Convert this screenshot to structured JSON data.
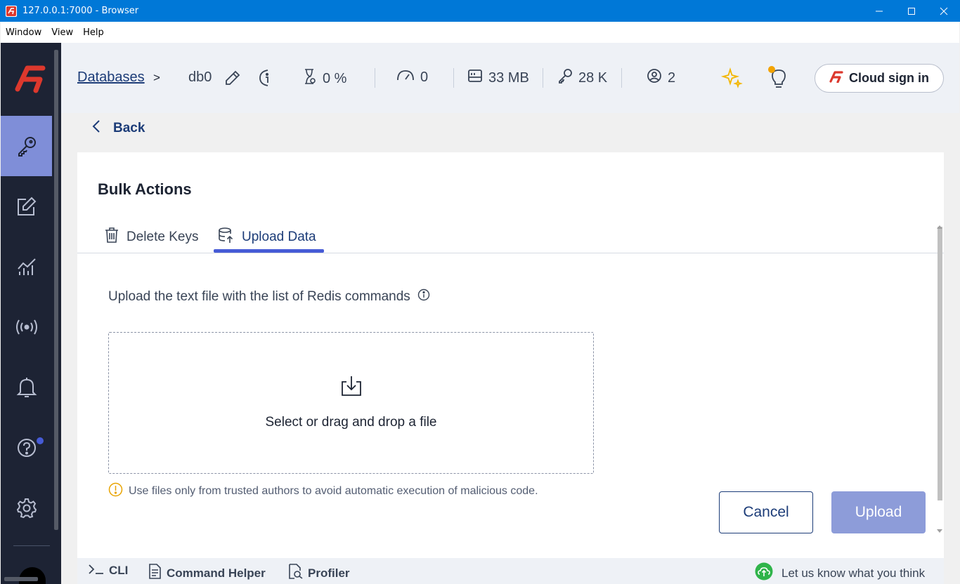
{
  "window": {
    "title": "127.0.0.1:7000 - Browser"
  },
  "menu": {
    "items": [
      "Window",
      "View",
      "Help"
    ]
  },
  "header": {
    "breadcrumb_databases": "Databases",
    "breadcrumb_sep": ">",
    "db_name": "db0",
    "stats": {
      "cpu": "0 %",
      "ops": "0",
      "memory": "33 MB",
      "keys": "28 K",
      "clients": "2"
    },
    "cloud_sign_in": "Cloud sign in"
  },
  "back_label": "Back",
  "panel": {
    "title": "Bulk Actions",
    "tabs": [
      {
        "label": "Delete Keys",
        "active": false
      },
      {
        "label": "Upload Data",
        "active": true
      }
    ],
    "upload_label": "Upload the text file with the list of Redis commands",
    "dropzone_text": "Select or drag and drop a file",
    "warning": "Use files only from trusted authors to avoid automatic execution of malicious code.",
    "cancel": "Cancel",
    "upload": "Upload"
  },
  "bottom": {
    "cli": "CLI",
    "command_helper": "Command Helper",
    "profiler": "Profiler",
    "feedback": "Let us know what you think"
  },
  "colors": {
    "titlebar": "#0078d7",
    "nav_bg": "#1d2334",
    "nav_active": "#7f8ed8",
    "accent": "#465bd6",
    "brand_red": "#dc382d"
  }
}
